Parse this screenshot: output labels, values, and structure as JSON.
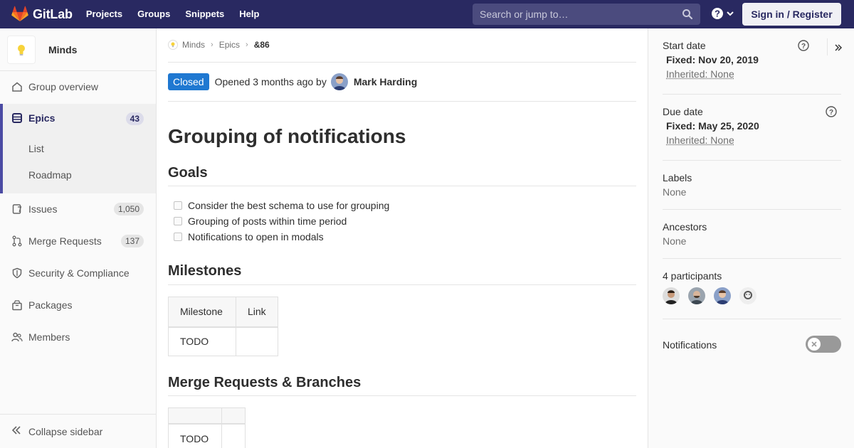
{
  "navbar": {
    "brand": "GitLab",
    "links": [
      "Projects",
      "Groups",
      "Snippets",
      "Help"
    ],
    "search_placeholder": "Search or jump to…",
    "signin_label": "Sign in / Register"
  },
  "sidebar": {
    "group_name": "Minds",
    "items": [
      {
        "label": "Group overview"
      },
      {
        "label": "Epics",
        "count": "43",
        "active": true
      },
      {
        "label": "Issues",
        "count": "1,050"
      },
      {
        "label": "Merge Requests",
        "count": "137"
      },
      {
        "label": "Security & Compliance"
      },
      {
        "label": "Packages"
      },
      {
        "label": "Members"
      }
    ],
    "subitems": [
      "List",
      "Roadmap"
    ],
    "collapse_label": "Collapse sidebar"
  },
  "breadcrumb": [
    "Minds",
    "Epics",
    "&86"
  ],
  "epic": {
    "status": "Closed",
    "opened_text": "Opened 3 months ago by",
    "author": "Mark Harding",
    "title": "Grouping of notifications",
    "sections": {
      "goals": "Goals",
      "milestones": "Milestones",
      "mrs": "Merge Requests & Branches"
    },
    "tasks": [
      "Consider the best schema to use for grouping",
      "Grouping of posts within time period",
      "Notifications to open in modals"
    ],
    "milestones_table": {
      "headers": [
        "Milestone",
        "Link"
      ],
      "rows": [
        [
          "TODO",
          ""
        ]
      ]
    },
    "mrs_table": {
      "headers": [
        "",
        ""
      ],
      "rows": [
        [
          "TODO",
          ""
        ]
      ]
    }
  },
  "right": {
    "start_date": {
      "label": "Start date",
      "fixed": "Fixed:",
      "fixed_value": "Nov 20, 2019",
      "inherited": "Inherited: None"
    },
    "due_date": {
      "label": "Due date",
      "fixed": "Fixed:",
      "fixed_value": "May 25, 2020",
      "inherited": "Inherited: None"
    },
    "labels": {
      "label": "Labels",
      "value": "None"
    },
    "ancestors": {
      "label": "Ancestors",
      "value": "None"
    },
    "participants": {
      "label": "4 participants"
    },
    "notifications": {
      "label": "Notifications",
      "enabled": false
    }
  },
  "colors": {
    "navbar": "#292961",
    "accent": "#4b4ba3",
    "closed_badge": "#1f78d1"
  }
}
